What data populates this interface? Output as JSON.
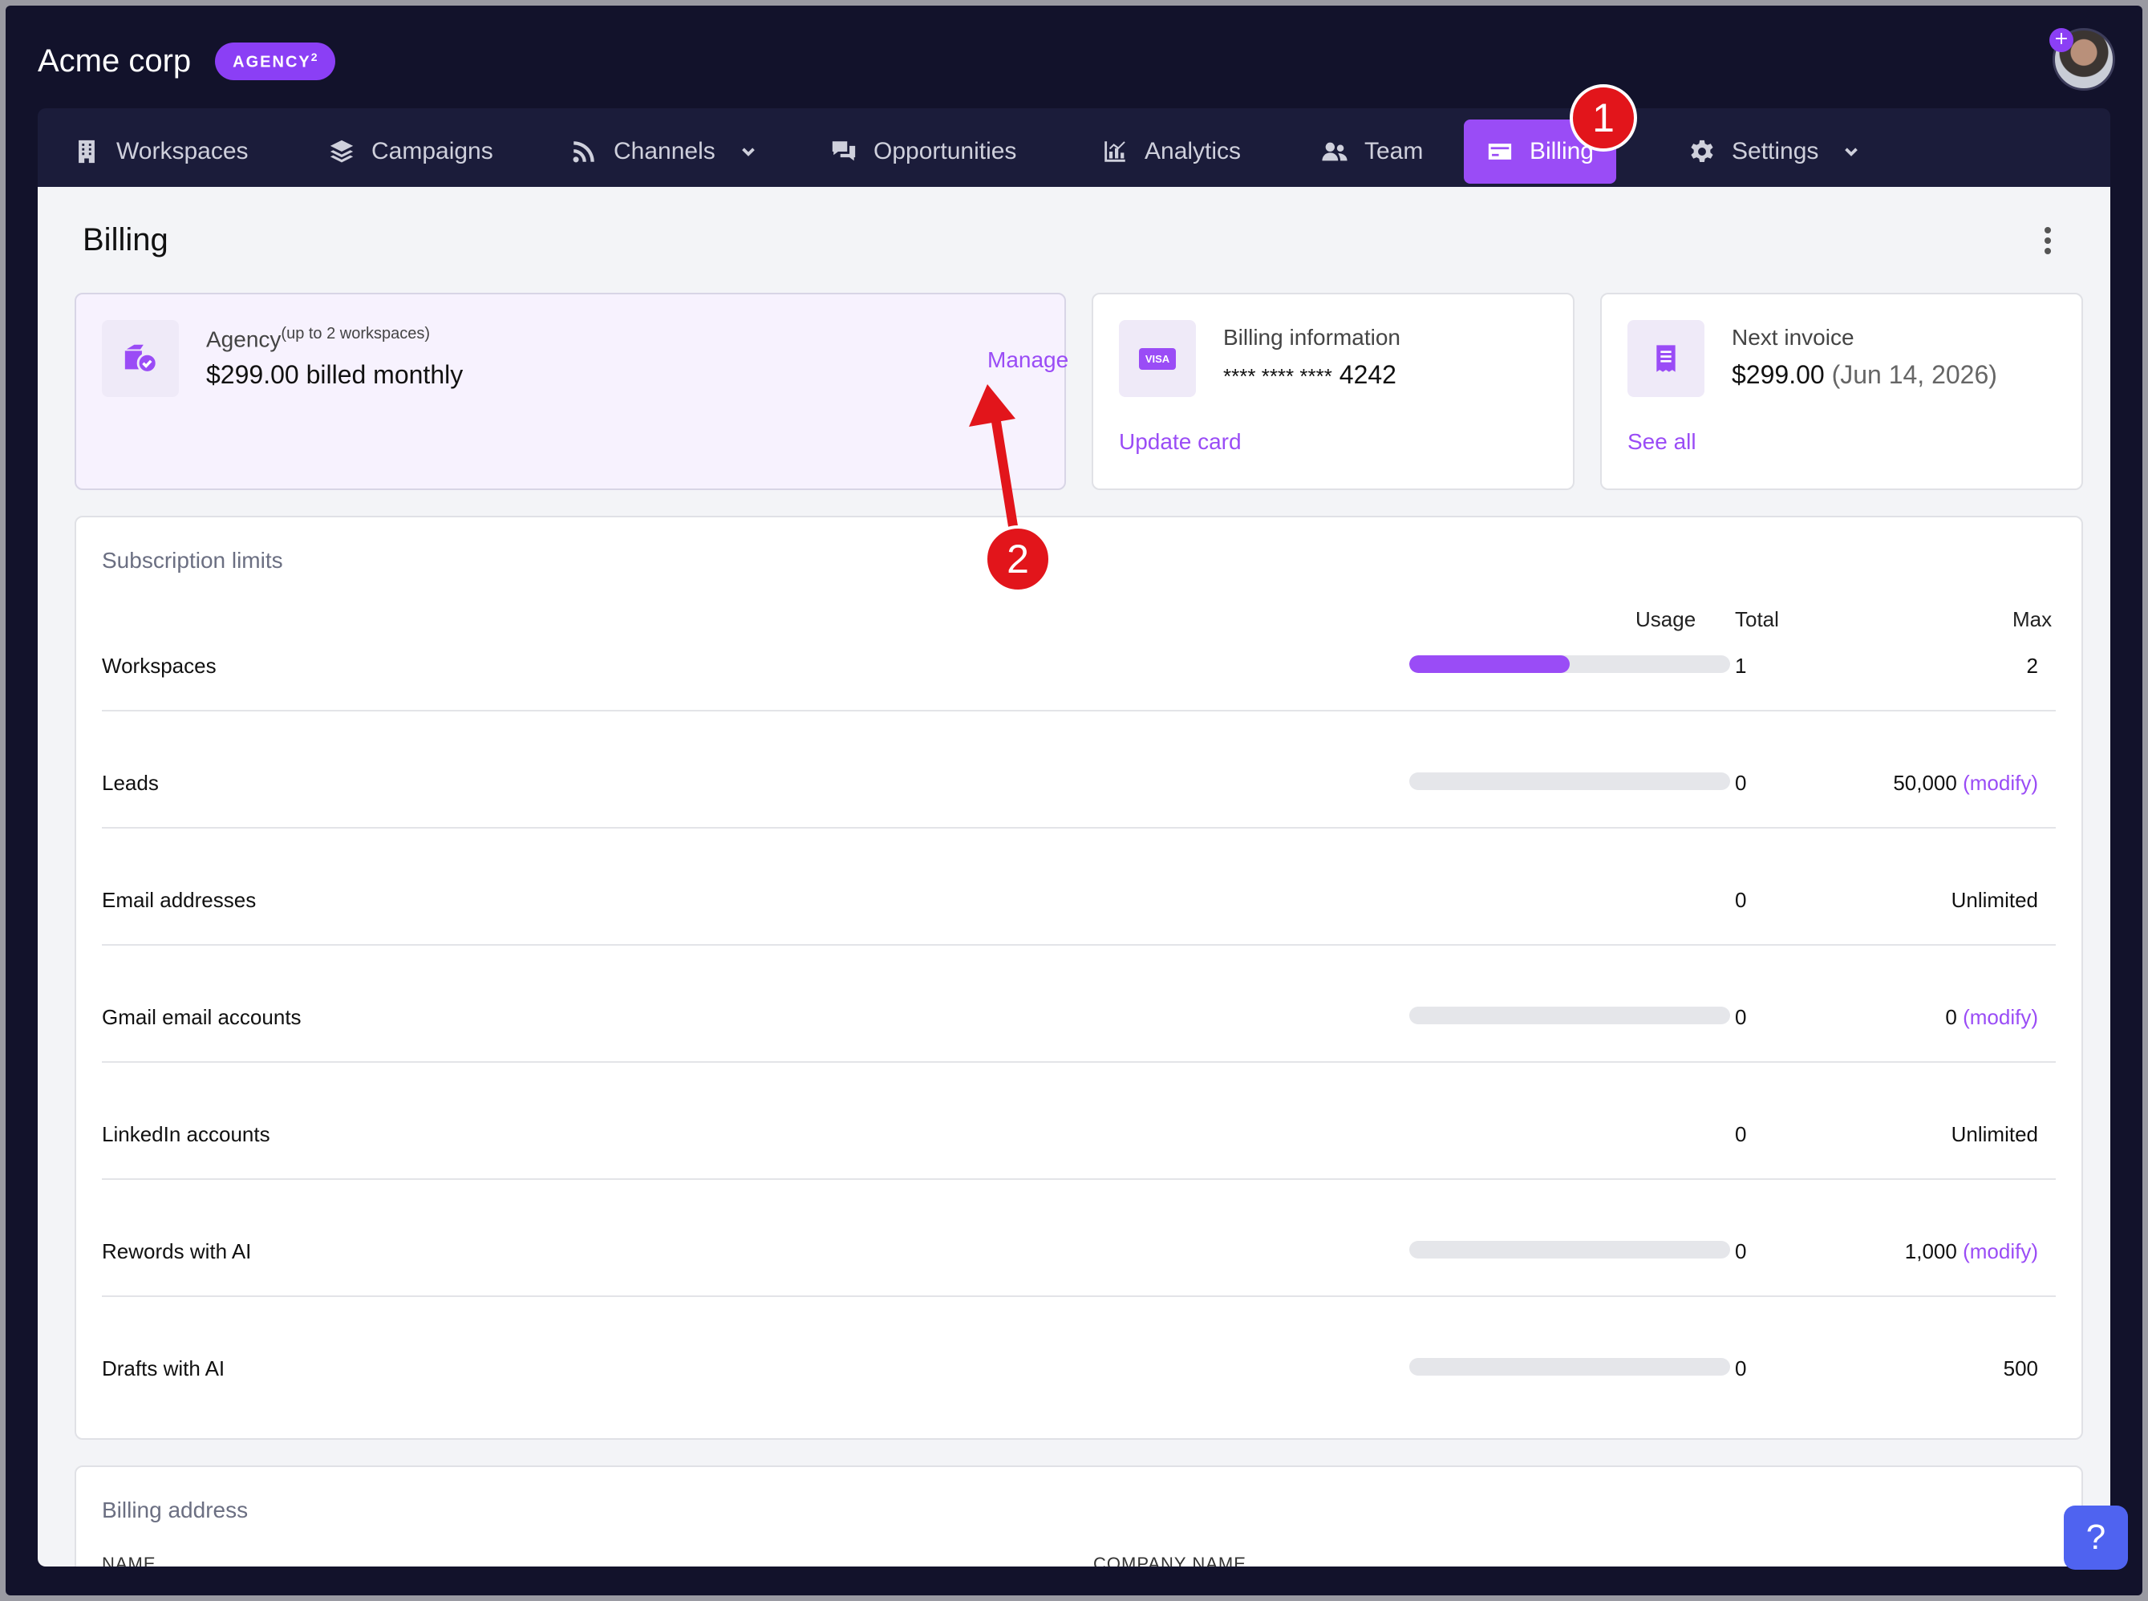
{
  "header": {
    "brand_name": "Acme corp",
    "plan_badge": "AGENCY",
    "plan_badge_sup": "2",
    "avatar_plus": "+"
  },
  "nav": {
    "items": [
      {
        "label": "Workspaces",
        "icon": "building-icon"
      },
      {
        "label": "Campaigns",
        "icon": "layers-icon"
      },
      {
        "label": "Channels",
        "icon": "rss-icon",
        "dropdown": true
      },
      {
        "label": "Opportunities",
        "icon": "chat-bubbles-icon"
      },
      {
        "label": "Analytics",
        "icon": "chart-icon"
      },
      {
        "label": "Team",
        "icon": "users-icon"
      },
      {
        "label": "Billing",
        "icon": "credit-card-icon",
        "active": true
      },
      {
        "label": "Settings",
        "icon": "gear-icon",
        "dropdown": true
      }
    ],
    "accent": "#9a4cf6"
  },
  "annotations": {
    "step1": "1",
    "step2": "2",
    "color": "#e2151b"
  },
  "page": {
    "title": "Billing"
  },
  "plan_card": {
    "label": "Agency",
    "label_sup": "(up to 2 workspaces)",
    "value": "$299.00 billed monthly",
    "manage": "Manage"
  },
  "billing_card": {
    "label": "Billing information",
    "card_mask": "**** **** ****",
    "card_last4": "4242",
    "card_brand": "VISA",
    "update": "Update card"
  },
  "invoice_card": {
    "label": "Next invoice",
    "amount": "$299.00",
    "date": "(Jun 14, 2026)",
    "see_all": "See all"
  },
  "limits": {
    "title": "Subscription limits",
    "headers": {
      "usage": "Usage",
      "total": "Total",
      "max": "Max"
    },
    "rows": [
      {
        "label": "Workspaces",
        "usage": 0.5,
        "total": "1",
        "max": "2",
        "modify": ""
      },
      {
        "label": "Leads",
        "usage": 0,
        "total": "0",
        "max": "50,000",
        "modify": "(modify)"
      },
      {
        "label": "Email addresses",
        "usage": null,
        "total": "0",
        "max": "Unlimited",
        "modify": ""
      },
      {
        "label": "Gmail email accounts",
        "usage": 0,
        "total": "0",
        "max": "0",
        "modify": "(modify)"
      },
      {
        "label": "LinkedIn accounts",
        "usage": null,
        "total": "0",
        "max": "Unlimited",
        "modify": ""
      },
      {
        "label": "Rewords with AI",
        "usage": 0,
        "total": "0",
        "max": "1,000",
        "modify": "(modify)"
      },
      {
        "label": "Drafts with AI",
        "usage": 0,
        "total": "0",
        "max": "500",
        "modify": ""
      }
    ]
  },
  "billing_address": {
    "title": "Billing address",
    "col_name": "NAME",
    "col_company": "COMPANY NAME"
  },
  "help": {
    "label": "?"
  }
}
